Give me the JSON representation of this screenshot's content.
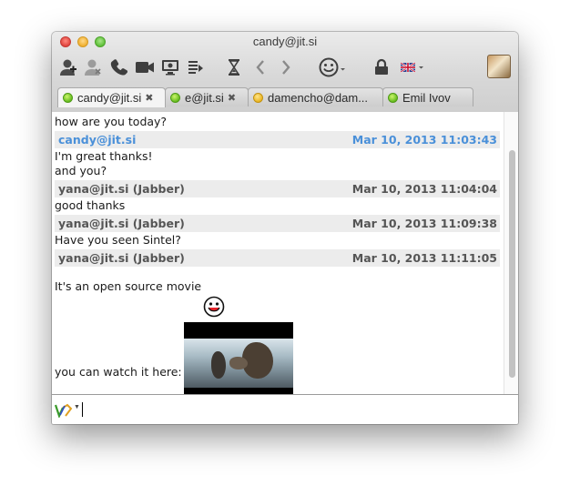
{
  "window": {
    "title": "candy@jit.si"
  },
  "toolbar": {
    "icons": [
      "add-contact-icon",
      "remove-contact-icon",
      "phone-icon",
      "video-call-icon",
      "desktop-share-icon",
      "send-file-icon",
      "history-icon",
      "back-icon",
      "forward-icon",
      "smiley-icon",
      "lock-icon",
      "flag-uk-icon",
      "avatar"
    ]
  },
  "tabs": [
    {
      "label": "candy@jit.si",
      "status": "online",
      "closable": true,
      "active": true
    },
    {
      "label": "e@jit.si",
      "status": "online",
      "closable": true,
      "active": false
    },
    {
      "label": "damencho@dam...",
      "status": "away",
      "closable": false,
      "active": false
    },
    {
      "label": "Emil Ivov",
      "status": "online",
      "closable": false,
      "active": false
    }
  ],
  "chat": {
    "partial_top": "how are you today?",
    "messages": [
      {
        "sender": "candy@jit.si",
        "time": "Mar 10, 2013 11:03:43",
        "lines": [
          "I'm great thanks!",
          "and you?"
        ],
        "is_me": true
      },
      {
        "sender": "yana@jit.si (Jabber)",
        "time": "Mar 10, 2013 11:04:04",
        "lines": [
          "good thanks"
        ],
        "is_me": false
      },
      {
        "sender": "yana@jit.si (Jabber)",
        "time": "Mar 10, 2013 11:09:38",
        "lines": [
          "Have you seen Sintel?"
        ],
        "is_me": false
      },
      {
        "sender": "yana@jit.si (Jabber)",
        "time": "Mar 10, 2013 11:11:05",
        "lines": [
          "It's an open source movie",
          "you can watch it here:"
        ],
        "is_me": false
      }
    ]
  },
  "colors": {
    "me_accent": "#4a90d9",
    "header_bg": "#ececec"
  }
}
